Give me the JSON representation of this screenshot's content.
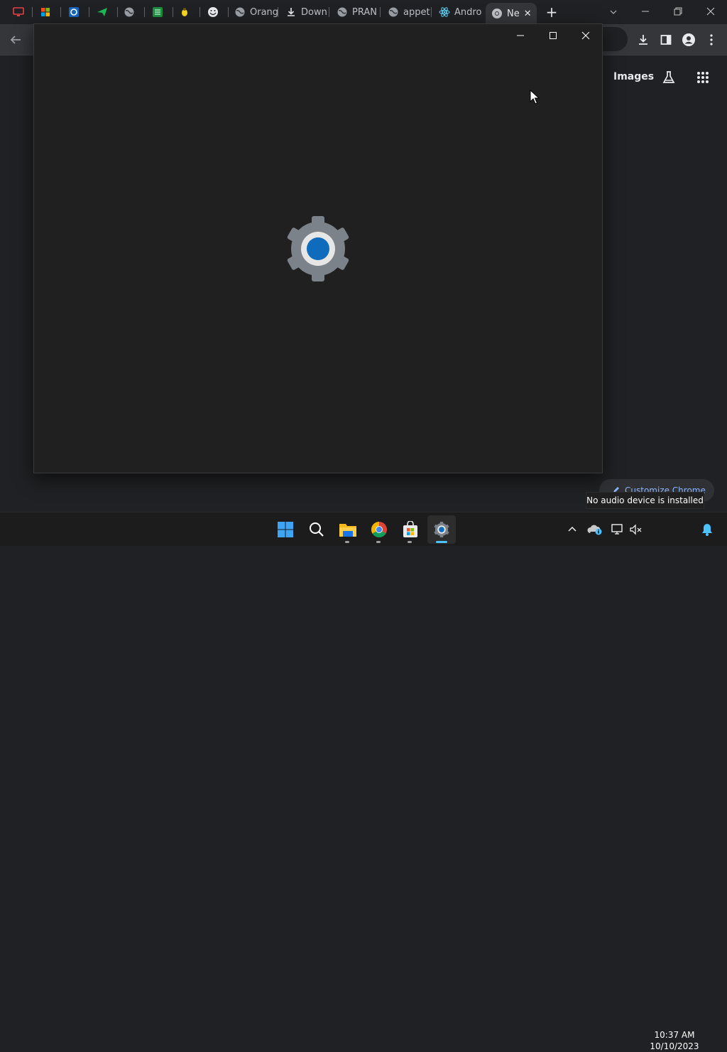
{
  "browser": {
    "tabs": [
      {
        "label": "",
        "icon": "remote-desktop-icon"
      },
      {
        "label": "",
        "icon": "windows-flag-icon"
      },
      {
        "label": "",
        "icon": "blue-app-icon"
      },
      {
        "label": "",
        "icon": "paper-plane-icon"
      },
      {
        "label": "",
        "icon": "globe-icon"
      },
      {
        "label": "",
        "icon": "grid-app-icon"
      },
      {
        "label": "",
        "icon": "bug-icon"
      },
      {
        "label": "",
        "icon": "troll-face-icon"
      },
      {
        "label": "Orang",
        "icon": "globe-icon"
      },
      {
        "label": "Down",
        "icon": "download-icon"
      },
      {
        "label": "PRAN",
        "icon": "globe-icon"
      },
      {
        "label": "appet",
        "icon": "globe-icon"
      },
      {
        "label": "Andro",
        "icon": "react-icon"
      },
      {
        "label": "Ne",
        "icon": "chrome-icon"
      }
    ],
    "new_tab_label": "+",
    "google_images_link": "Images",
    "customize_label": "Customize Chrome"
  },
  "notification": {
    "text": "No audio device is installed"
  },
  "taskbar": {
    "time": "10:37 AM",
    "date": "10/10/2023",
    "apps": [
      "start",
      "search",
      "file-explorer",
      "chrome",
      "microsoft-store",
      "settings"
    ]
  },
  "colors": {
    "accent": "#4cc2ff",
    "gear_blue": "#0f6cbd",
    "gear_gray": "#7c8289"
  }
}
